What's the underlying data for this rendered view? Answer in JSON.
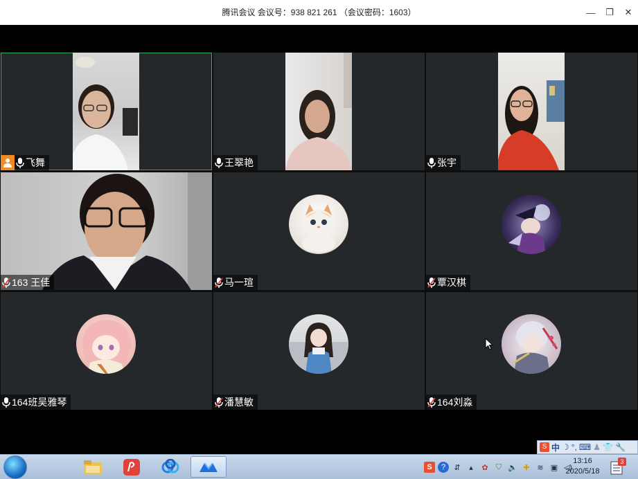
{
  "window": {
    "title": "腾讯会议 会议号：938 821 261 （会议密码：1603）",
    "controls": {
      "minimize": "—",
      "restore": "❐",
      "close": "✕"
    }
  },
  "participants": [
    {
      "name": "飞舞",
      "host": true,
      "mic": "on",
      "kind": "video",
      "active_speaker": true
    },
    {
      "name": "王翠艳",
      "host": false,
      "mic": "on",
      "kind": "video"
    },
    {
      "name": "张宇",
      "host": false,
      "mic": "on",
      "kind": "video"
    },
    {
      "name": "163 王佳",
      "host": false,
      "mic": "muted",
      "kind": "video"
    },
    {
      "name": "马一瑄",
      "host": false,
      "mic": "muted",
      "kind": "avatar",
      "avatar_icon": "kitten-avatar-icon"
    },
    {
      "name": "覃汉棋",
      "host": false,
      "mic": "muted",
      "kind": "avatar",
      "avatar_icon": "anime-witch-avatar-icon"
    },
    {
      "name": "164班吴雅琴",
      "host": false,
      "mic": "on",
      "kind": "avatar",
      "avatar_icon": "anime-girl-avatar-icon"
    },
    {
      "name": "潘慧敏",
      "host": false,
      "mic": "muted",
      "kind": "avatar",
      "avatar_icon": "doll-avatar-icon"
    },
    {
      "name": "164刘淼",
      "host": false,
      "mic": "muted",
      "kind": "avatar",
      "avatar_icon": "anime-swordsman-avatar-icon"
    }
  ],
  "ime": {
    "mode": "中"
  },
  "taskbar": {
    "apps": [
      "file-explorer-icon",
      "wps-pdf-icon",
      "baidu-netdisk-icon",
      "tencent-meeting-icon"
    ],
    "clock_time": "13:16",
    "clock_date": "2020/5/18",
    "notification_count": "3"
  },
  "colors": {
    "accent_green": "#2fb35b",
    "host_orange": "#f08a24",
    "muted_red": "#e0413a",
    "tile_bg": "#24282b"
  }
}
